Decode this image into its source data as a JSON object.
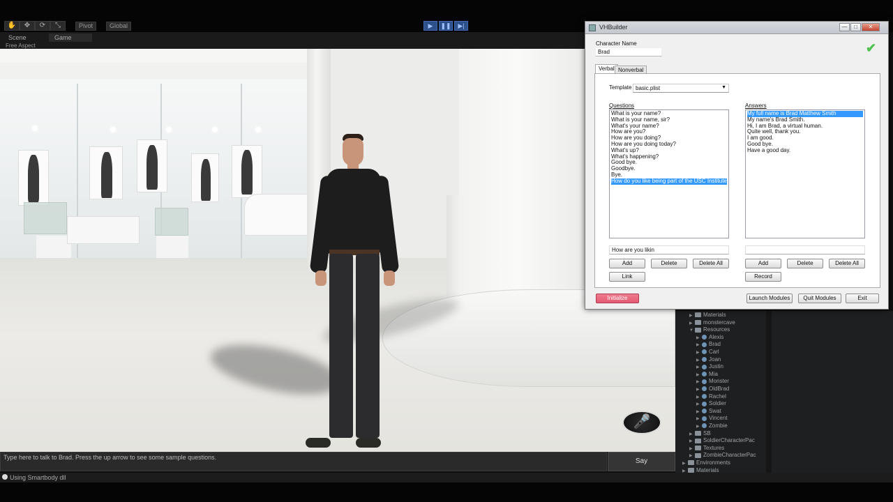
{
  "toolbar": {
    "pivot_label": "Pivot",
    "global_label": "Global",
    "play_icon": "▶",
    "pause_icon": "❚❚",
    "step_icon": "▶|"
  },
  "view_tabs": {
    "scene": "Scene",
    "game": "Game",
    "aspect": "Free Aspect"
  },
  "game": {
    "talk_placeholder": "Type here to talk to Brad. Press the up arrow to see some sample questions.",
    "say_label": "Say",
    "mic_icon": "microphone-icon"
  },
  "status": {
    "message": "Using Smartbody dll"
  },
  "project_tree": [
    {
      "label": "Materials",
      "kind": "folder",
      "indent": 2,
      "arrow": "▶"
    },
    {
      "label": "monstercave",
      "kind": "folder",
      "indent": 2,
      "arrow": "▶"
    },
    {
      "label": "Resources",
      "kind": "folder",
      "indent": 2,
      "arrow": "▼"
    },
    {
      "label": "Alexis",
      "kind": "prefab",
      "indent": 3,
      "arrow": "▶"
    },
    {
      "label": "Brad",
      "kind": "prefab",
      "indent": 3,
      "arrow": "▶"
    },
    {
      "label": "Carl",
      "kind": "prefab",
      "indent": 3,
      "arrow": "▶"
    },
    {
      "label": "Joan",
      "kind": "prefab",
      "indent": 3,
      "arrow": "▶"
    },
    {
      "label": "Justin",
      "kind": "prefab",
      "indent": 3,
      "arrow": "▶"
    },
    {
      "label": "Mia",
      "kind": "prefab",
      "indent": 3,
      "arrow": "▶"
    },
    {
      "label": "Monster",
      "kind": "prefab",
      "indent": 3,
      "arrow": "▶"
    },
    {
      "label": "OldBrad",
      "kind": "prefab",
      "indent": 3,
      "arrow": "▶"
    },
    {
      "label": "Rachel",
      "kind": "prefab",
      "indent": 3,
      "arrow": "▶"
    },
    {
      "label": "Soldier",
      "kind": "prefab",
      "indent": 3,
      "arrow": "▶"
    },
    {
      "label": "Swat",
      "kind": "prefab",
      "indent": 3,
      "arrow": "▶"
    },
    {
      "label": "Vincent",
      "kind": "prefab",
      "indent": 3,
      "arrow": "▶"
    },
    {
      "label": "Zombie",
      "kind": "prefab",
      "indent": 3,
      "arrow": "▶"
    },
    {
      "label": "SB",
      "kind": "folder",
      "indent": 2,
      "arrow": "▶"
    },
    {
      "label": "SoldierCharacterPac",
      "kind": "folder",
      "indent": 2,
      "arrow": "▶"
    },
    {
      "label": "Textures",
      "kind": "folder",
      "indent": 2,
      "arrow": "▶"
    },
    {
      "label": "ZombieCharacterPac",
      "kind": "folder",
      "indent": 2,
      "arrow": "▶"
    },
    {
      "label": "Environments",
      "kind": "folder",
      "indent": 1,
      "arrow": "▶"
    },
    {
      "label": "Materials",
      "kind": "folder",
      "indent": 1,
      "arrow": "▶"
    }
  ],
  "vhbuilder": {
    "title": "VHBuilder",
    "character_name_label": "Character Name",
    "character_name_value": "Brad",
    "tabs": [
      "Verbal",
      "Nonverbal"
    ],
    "template_label": "Template",
    "template_value": "basic.plist",
    "questions_label": "Questions",
    "answers_label": "Answers",
    "questions": [
      "What is your name?",
      "What is your name, sir?",
      "What's your name?",
      "How are you?",
      "How are you doing?",
      "How are you doing today?",
      "What's up?",
      "What's happening?",
      "Good bye.",
      "Goodbye.",
      "Bye.",
      "How do you like being part of the USC Institute for Cre"
    ],
    "selected_question_index": 11,
    "answers": [
      "My full name is Brad Matthew Smith",
      "My name's Brad Smith.",
      "Hi, I am Brad, a virtual human.",
      "Quite well, thank you.",
      "I am good.",
      "Good bye.",
      "Have a good day."
    ],
    "selected_answer_index": 0,
    "question_input_value": "How are you likin",
    "answer_input_value": "",
    "buttons": {
      "q_add": "Add",
      "q_delete": "Delete",
      "q_delete_all": "Delete All",
      "link": "Link",
      "a_add": "Add",
      "a_delete": "Delete",
      "a_delete_all": "Delete All",
      "record": "Record",
      "initialize": "Initialize",
      "launch_modules": "Launch Modules",
      "quit_modules": "Quit Modules",
      "exit": "Exit"
    },
    "window_buttons": {
      "minimize": "—",
      "maximize": "□",
      "close": "✕"
    },
    "status_check": "✔"
  }
}
